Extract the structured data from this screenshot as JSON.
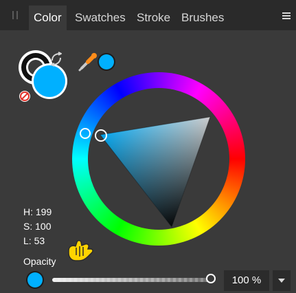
{
  "tabs": [
    {
      "label": "Color",
      "active": true
    },
    {
      "label": "Swatches",
      "active": false
    },
    {
      "label": "Stroke",
      "active": false
    },
    {
      "label": "Brushes",
      "active": false
    }
  ],
  "colors": {
    "fill": "#00b0ff",
    "stroke": "#111111",
    "accent": "#00b0ff"
  },
  "hsl": {
    "h_label": "H: 199",
    "s_label": "S: 100",
    "l_label": "L: 53"
  },
  "opacity": {
    "label": "Opacity",
    "value_text": "100 %",
    "level": 1.0
  },
  "icons": {
    "menu": "menu-icon",
    "grip": "panel-grip-icon",
    "swap": "swap-colors-icon",
    "none": "no-color-icon",
    "picker": "color-picker-icon",
    "hand": "hand-cursor-icon",
    "dropdown": "chevron-down-icon"
  }
}
